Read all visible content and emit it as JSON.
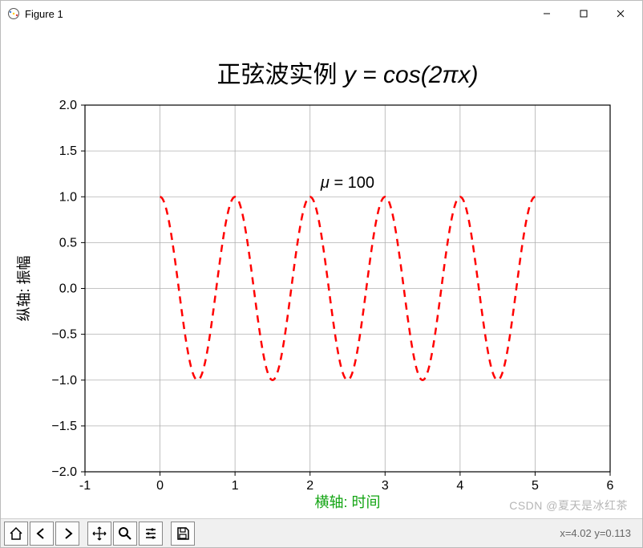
{
  "window": {
    "title": "Figure 1"
  },
  "toolbar": {
    "coord_readout": "x=4.02 y=0.113"
  },
  "watermark": "CSDN @夏天是冰红茶",
  "chart_data": {
    "type": "line",
    "title": "正弦波实例 $y=cos(2\\pi x)$",
    "xlabel": "横轴: 时间",
    "ylabel": "纵轴: 振幅",
    "xlim": [
      -1,
      6
    ],
    "ylim": [
      -2.0,
      2.0
    ],
    "xticks": [
      -1,
      0,
      1,
      2,
      3,
      4,
      5,
      6
    ],
    "yticks": [
      -2.0,
      -1.5,
      -1.0,
      -0.5,
      0.0,
      0.5,
      1.0,
      1.5,
      2.0
    ],
    "annotation": {
      "text": "μ = 100",
      "x": 2.5,
      "y": 1.1
    },
    "series": [
      {
        "name": "cos(2πx)",
        "color": "#ff0000",
        "linestyle": "dashed",
        "function": "cos(2*pi*x)",
        "x_range": [
          0.0,
          5.0
        ],
        "sample_values": {
          "x": [
            0.0,
            0.25,
            0.5,
            0.75,
            1.0,
            1.25,
            1.5,
            1.75,
            2.0,
            2.25,
            2.5,
            2.75,
            3.0,
            3.25,
            3.5,
            3.75,
            4.0,
            4.25,
            4.5,
            4.75,
            5.0
          ],
          "y": [
            1.0,
            0.0,
            -1.0,
            0.0,
            1.0,
            0.0,
            -1.0,
            0.0,
            1.0,
            0.0,
            -1.0,
            0.0,
            1.0,
            0.0,
            -1.0,
            0.0,
            1.0,
            0.0,
            -1.0,
            0.0,
            1.0
          ]
        }
      }
    ]
  }
}
